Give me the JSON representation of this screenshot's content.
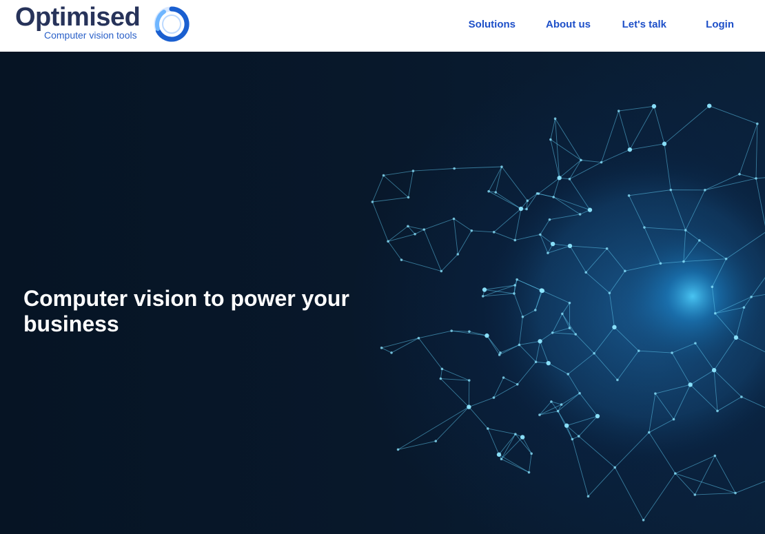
{
  "brand": {
    "name": "Optimised",
    "tagline": "Computer vision tools",
    "colors": {
      "name": "#27335a",
      "tagline": "#2a60c8",
      "ring": "#1a5fd0",
      "ring_light": "#6fb6ff"
    }
  },
  "nav": {
    "items": [
      {
        "label": "Solutions"
      },
      {
        "label": "About us"
      },
      {
        "label": "Let's talk"
      },
      {
        "label": "Login"
      }
    ],
    "color": "#1d4fc8"
  },
  "hero": {
    "title": "Computer vision to power your business",
    "background": "#071526",
    "accent": "#5ad8ff",
    "image": "network-eye-illustration"
  }
}
